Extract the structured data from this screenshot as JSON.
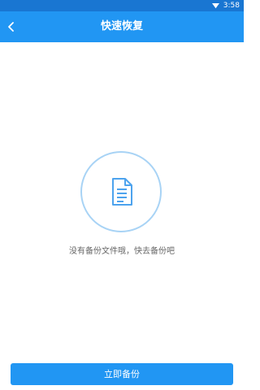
{
  "status_bar": {
    "time": "3:58",
    "wifi_icon": "wifi-icon",
    "background": "#1976d2"
  },
  "app_bar": {
    "title": "快速恢复",
    "back_icon": "chevron-left-icon",
    "background": "#2196f3"
  },
  "empty_state": {
    "icon": "document-icon",
    "message": "没有备份文件哦，快去备份吧"
  },
  "actions": {
    "backup_label": "立即备份"
  },
  "colors": {
    "accent": "#2196f3",
    "circle_border": "#a8d3f5",
    "icon": "#4da3ee"
  }
}
